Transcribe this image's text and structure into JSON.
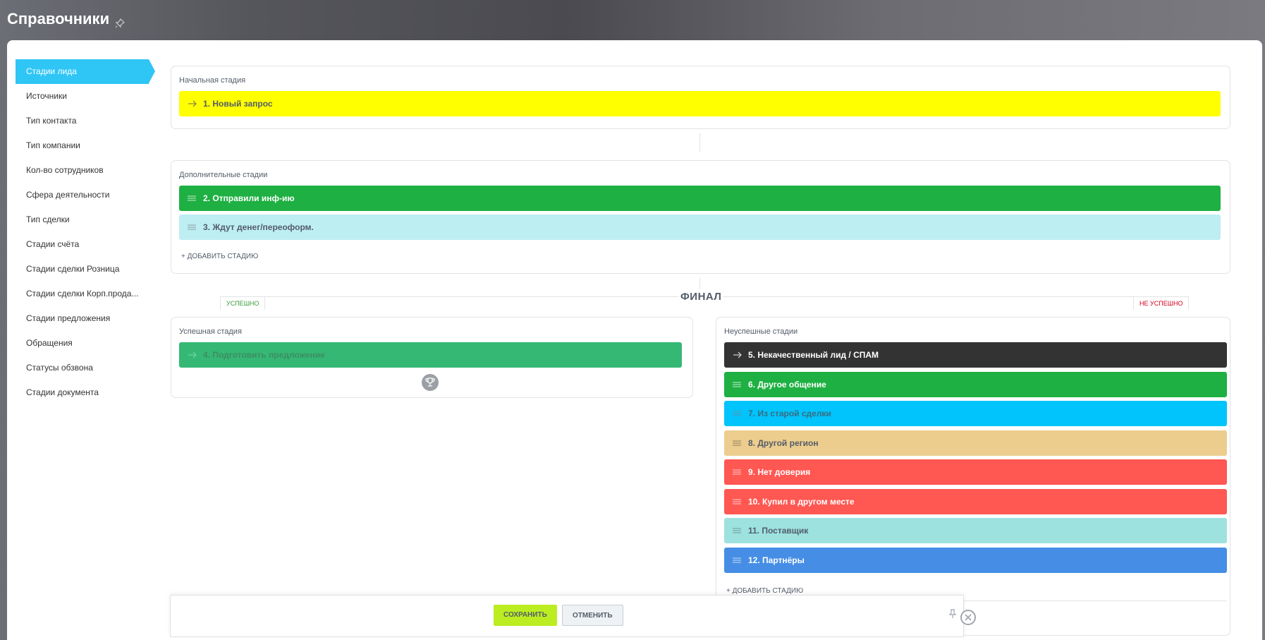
{
  "header": {
    "title": "Справочники"
  },
  "sidebar": {
    "items": [
      {
        "label": "Стадии лида"
      },
      {
        "label": "Источники"
      },
      {
        "label": "Тип контакта"
      },
      {
        "label": "Тип компании"
      },
      {
        "label": "Кол-во сотрудников"
      },
      {
        "label": "Сфера деятельности"
      },
      {
        "label": "Тип сделки"
      },
      {
        "label": "Стадии счёта"
      },
      {
        "label": "Стадии сделки Розница"
      },
      {
        "label": "Стадии сделки Корп.прода..."
      },
      {
        "label": "Стадии предложения"
      },
      {
        "label": "Обращения"
      },
      {
        "label": "Статусы обзвона"
      },
      {
        "label": "Стадии документа"
      }
    ]
  },
  "initial": {
    "title": "Начальная стадия",
    "stage": {
      "label": "1. Новый запрос",
      "color": "#ffff00",
      "icon": "arrow-right-icon"
    }
  },
  "additional": {
    "title": "Дополнительные стадии",
    "stages": [
      {
        "label": "2. Отправили инф-ию",
        "color": "#1eb042",
        "icon": "drag-handle-icon"
      },
      {
        "label": "3. Ждут денег/переоформ.",
        "color": "#bdeef2",
        "icon": "drag-handle-icon"
      }
    ],
    "add_label": "+ ДОБАВИТЬ СТАДИЮ"
  },
  "final": {
    "title": "ФИНАЛ",
    "success_tag": "УСПЕШНО",
    "fail_tag": "НЕ УСПЕШНО"
  },
  "success": {
    "title": "Успешная стадия",
    "stage": {
      "label": "4. Подготовить предложение",
      "color": "#35b874",
      "icon": "arrow-right-icon"
    }
  },
  "failure": {
    "title": "Неуспешные стадии",
    "stages": [
      {
        "label": "5. Некачественный лид / СПАМ",
        "color": "#333333",
        "icon": "arrow-right-icon"
      },
      {
        "label": "6. Другое общение",
        "color": "#1eb042",
        "icon": "drag-handle-icon"
      },
      {
        "label": "7. Из старой сделки",
        "color": "#00c4fb",
        "icon": "drag-handle-icon"
      },
      {
        "label": "8. Другой регион",
        "color": "#eccd8e",
        "icon": "drag-handle-icon"
      },
      {
        "label": "9. Нет доверия",
        "color": "#ff5752",
        "icon": "drag-handle-icon"
      },
      {
        "label": "10. Купил в другом месте",
        "color": "#ff5752",
        "icon": "drag-handle-icon"
      },
      {
        "label": "11. Поставщик",
        "color": "#9de2de",
        "icon": "drag-handle-icon"
      },
      {
        "label": "12. Партнёры",
        "color": "#468ee5",
        "icon": "drag-handle-icon"
      }
    ],
    "add_label": "+ ДОБАВИТЬ СТАДИЮ"
  },
  "footer": {
    "save_label": "СОХРАНИТЬ",
    "cancel_label": "ОТМЕНИТЬ"
  }
}
